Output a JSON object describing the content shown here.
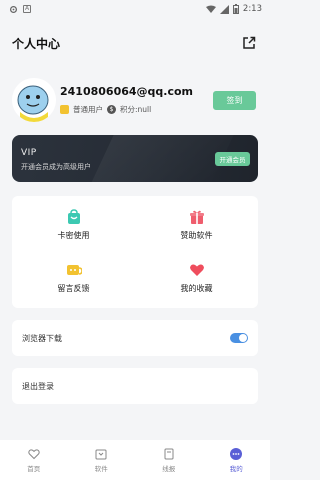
{
  "status_bar": {
    "time": "2:13",
    "left_icons": [
      "settings-icon",
      "a-icon"
    ],
    "right_icons": [
      "wifi-icon",
      "signal-icon",
      "battery-icon"
    ]
  },
  "header": {
    "title": "个人中心",
    "share_icon": "share-icon"
  },
  "profile": {
    "email": "2410806064@qq.com",
    "user_type": "普通用户",
    "points": "积分:null",
    "signin_label": "签到"
  },
  "vip": {
    "title": "VIP",
    "subtitle": "开通会员成为高级用户",
    "button_label": "开通会员"
  },
  "grid": {
    "items": [
      {
        "label": "卡密使用",
        "icon": "bag-icon",
        "color": "#3cc9b2"
      },
      {
        "label": "赞助软件",
        "icon": "gift-icon",
        "color": "#ef5d6d"
      },
      {
        "label": "留言反馈",
        "icon": "feedback-icon",
        "color": "#f2c230"
      },
      {
        "label": "我的收藏",
        "icon": "heart-icon",
        "color": "#ef4d5d"
      }
    ]
  },
  "settings": {
    "browser_download": {
      "label": "浏览器下载",
      "enabled": true
    },
    "logout": {
      "label": "退出登录"
    }
  },
  "tabbar": {
    "tabs": [
      {
        "label": "首页",
        "icon": "heart-outline-icon"
      },
      {
        "label": "软件",
        "icon": "box-icon"
      },
      {
        "label": "线报",
        "icon": "bookmark-icon"
      },
      {
        "label": "我的",
        "icon": "profile-dots-icon"
      }
    ],
    "active_index": 3,
    "active_color": "#5a5fd6"
  }
}
